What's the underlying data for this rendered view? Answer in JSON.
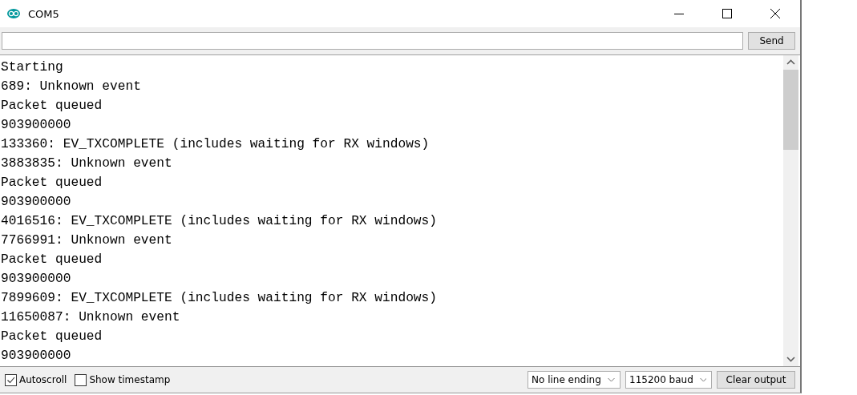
{
  "window": {
    "title": "COM5"
  },
  "send_button": "Send",
  "output": [
    "Starting",
    "689: Unknown event",
    "Packet queued",
    "903900000",
    "133360: EV_TXCOMPLETE (includes waiting for RX windows)",
    "3883835: Unknown event",
    "Packet queued",
    "903900000",
    "4016516: EV_TXCOMPLETE (includes waiting for RX windows)",
    "7766991: Unknown event",
    "Packet queued",
    "903900000",
    "7899609: EV_TXCOMPLETE (includes waiting for RX windows)",
    "11650087: Unknown event",
    "Packet queued",
    "903900000"
  ],
  "options": [
    {
      "label": "Autoscroll",
      "checked": true
    },
    {
      "label": "Show timestamp",
      "checked": false
    }
  ],
  "line_ending": "No line ending",
  "baud": "115200 baud",
  "clear_button": "Clear output"
}
